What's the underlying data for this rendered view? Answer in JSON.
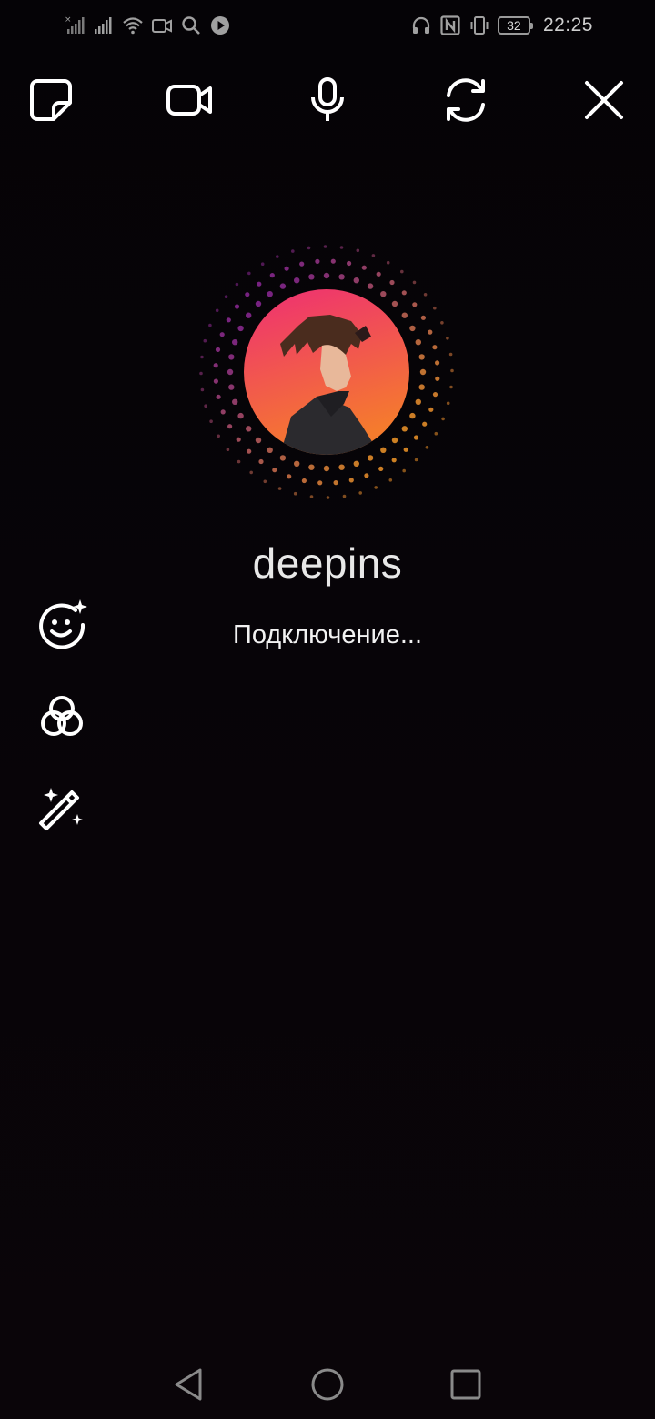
{
  "status_bar": {
    "left_icons": [
      "no-sim-signal-icon",
      "signal-icon",
      "wifi-icon",
      "video-recording-icon",
      "search-icon",
      "play-icon"
    ],
    "right_icons": [
      "headset-icon",
      "nfc-icon",
      "vibrate-icon"
    ],
    "battery_level": "32",
    "time": "22:25"
  },
  "toolbar": {
    "icons": [
      "sticker-icon",
      "video-camera-icon",
      "microphone-icon",
      "switch-camera-icon",
      "close-icon"
    ]
  },
  "contact": {
    "username": "deepins",
    "status": "Подключение..."
  },
  "side_tools": {
    "icons": [
      "effects-face-icon",
      "color-filter-icon",
      "magic-wand-icon"
    ]
  },
  "nav_bar": {
    "icons": [
      "back-icon",
      "home-icon",
      "recents-icon"
    ]
  },
  "colors": {
    "background": "#060307",
    "icon": "#ffffff",
    "status_icon": "#a0a0a0",
    "avatar_gradient_top": "#ee2f73",
    "avatar_gradient_bottom": "#f57b2d"
  }
}
